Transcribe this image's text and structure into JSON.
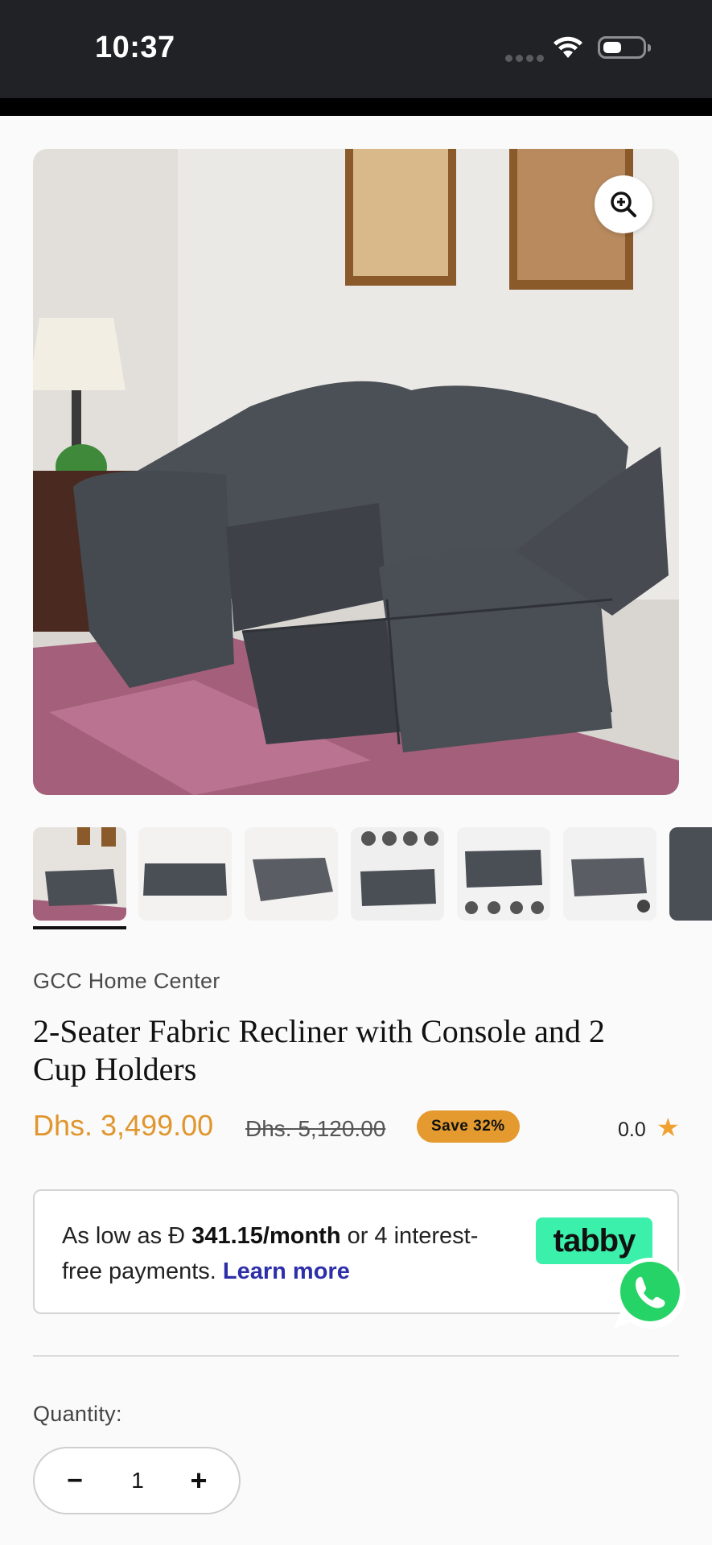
{
  "status_bar": {
    "time": "10:37"
  },
  "product": {
    "brand": "GCC Home Center",
    "title": "2-Seater Fabric Recliner with Console and 2 Cup Holders",
    "price": "Dhs. 3,499.00",
    "old_price": "Dhs. 5,120.00",
    "save_badge": "Save 32%",
    "rating": "0.0",
    "thumbnail_count": 7,
    "selected_thumbnail": 1
  },
  "installments": {
    "prefix": "As low as ",
    "currency_symbol": "Đ",
    "amount": "341.15/month",
    "middle": " or 4 interest-free payments. ",
    "link": "Learn more",
    "provider_logo": "tabby"
  },
  "quantity": {
    "label": "Quantity:",
    "value": "1",
    "minus": "−",
    "plus": "+"
  },
  "colors": {
    "price": "#e0962e",
    "badge": "#e49a2f",
    "tabby": "#3bf0aa",
    "link": "#2d2fa9",
    "star": "#f0a132"
  }
}
